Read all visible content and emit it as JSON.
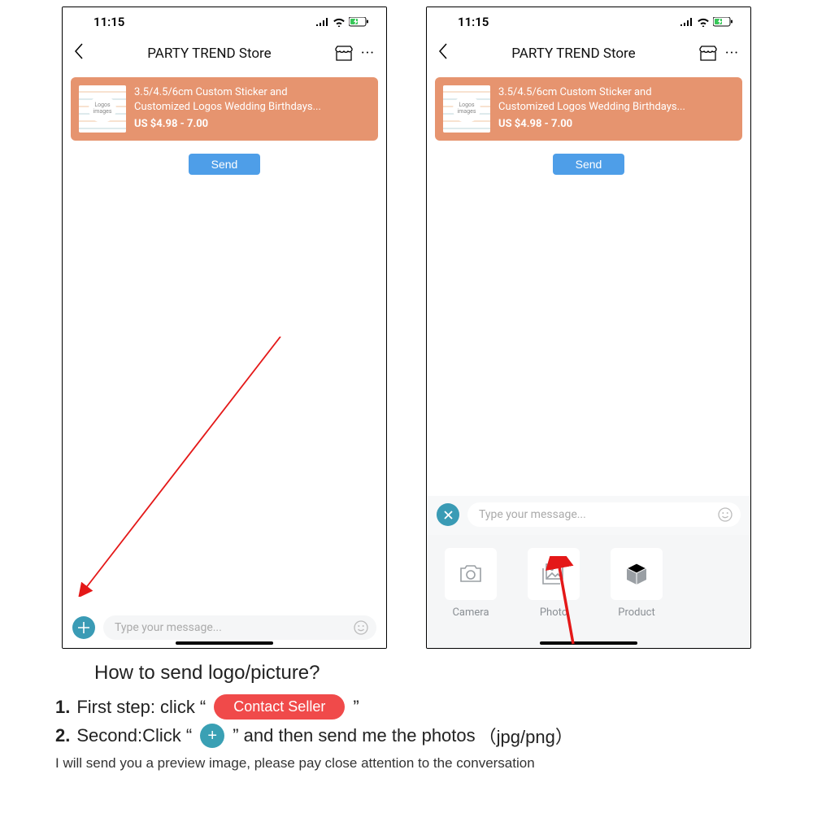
{
  "status": {
    "time": "11:15"
  },
  "nav": {
    "title": "PARTY TREND Store"
  },
  "product": {
    "thumb_text": "Logos images",
    "title_line1": "3.5/4.5/6cm Custom Sticker and",
    "title_line2": "Customized Logos Wedding Birthdays...",
    "price": "US $4.98 - 7.00"
  },
  "send_label": "Send",
  "input": {
    "placeholder": "Type your message..."
  },
  "attach": {
    "camera": "Camera",
    "photo": "Photo",
    "product": "Product"
  },
  "instructions": {
    "question": "How to send logo/picture?",
    "step1_prefix": "First step: click “",
    "step1_button": "Contact Seller",
    "step1_suffix": "”",
    "step2_prefix": "Second:Click “",
    "step2_mid": "” and then send me the photos",
    "step2_suffix": "（jpg/png）",
    "note": "I will send you a preview image, please pay close attention to the conversation"
  }
}
